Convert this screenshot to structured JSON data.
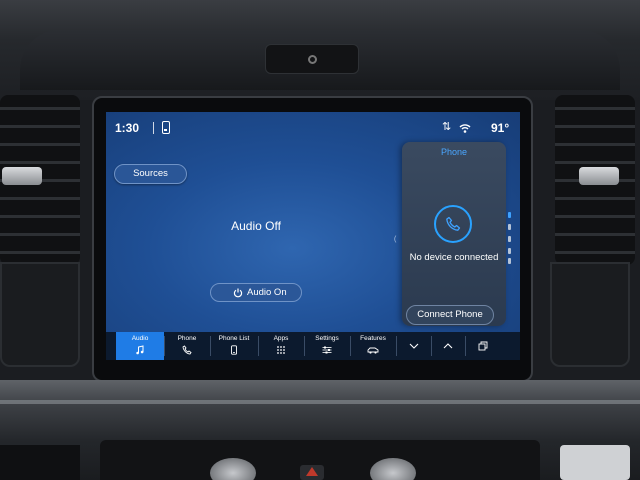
{
  "status_bar": {
    "time": "1:30",
    "temperature": "91°",
    "icons": [
      "phone-status-icon",
      "signal-icon",
      "wifi-icon"
    ]
  },
  "audio": {
    "sources_label": "Sources",
    "status_text": "Audio Off",
    "audio_on_label": "Audio On",
    "power_icon": "power-icon"
  },
  "phone_panel": {
    "title": "Phone",
    "icon": "phone-icon",
    "status_text": "No device connected",
    "connect_label": "Connect Phone"
  },
  "bottom_bar": {
    "items": [
      {
        "label": "Audio",
        "icon": "music-note-icon",
        "active": true
      },
      {
        "label": "Phone",
        "icon": "phone-icon",
        "active": false
      },
      {
        "label": "Phone List",
        "icon": "phone-list-icon",
        "active": false
      },
      {
        "label": "Apps",
        "icon": "apps-grid-icon",
        "active": false
      },
      {
        "label": "Settings",
        "icon": "sliders-icon",
        "active": false
      },
      {
        "label": "Features",
        "icon": "car-icon",
        "active": false
      }
    ],
    "controls": [
      "chevron-down-icon",
      "chevron-up-icon",
      "window-stack-icon"
    ]
  },
  "colors": {
    "screen_bg": "#1f4f95",
    "accent_blue": "#1f7ce6",
    "phone_title": "#4aa6ff",
    "bottom_bar_bg": "#0c1a2e"
  }
}
